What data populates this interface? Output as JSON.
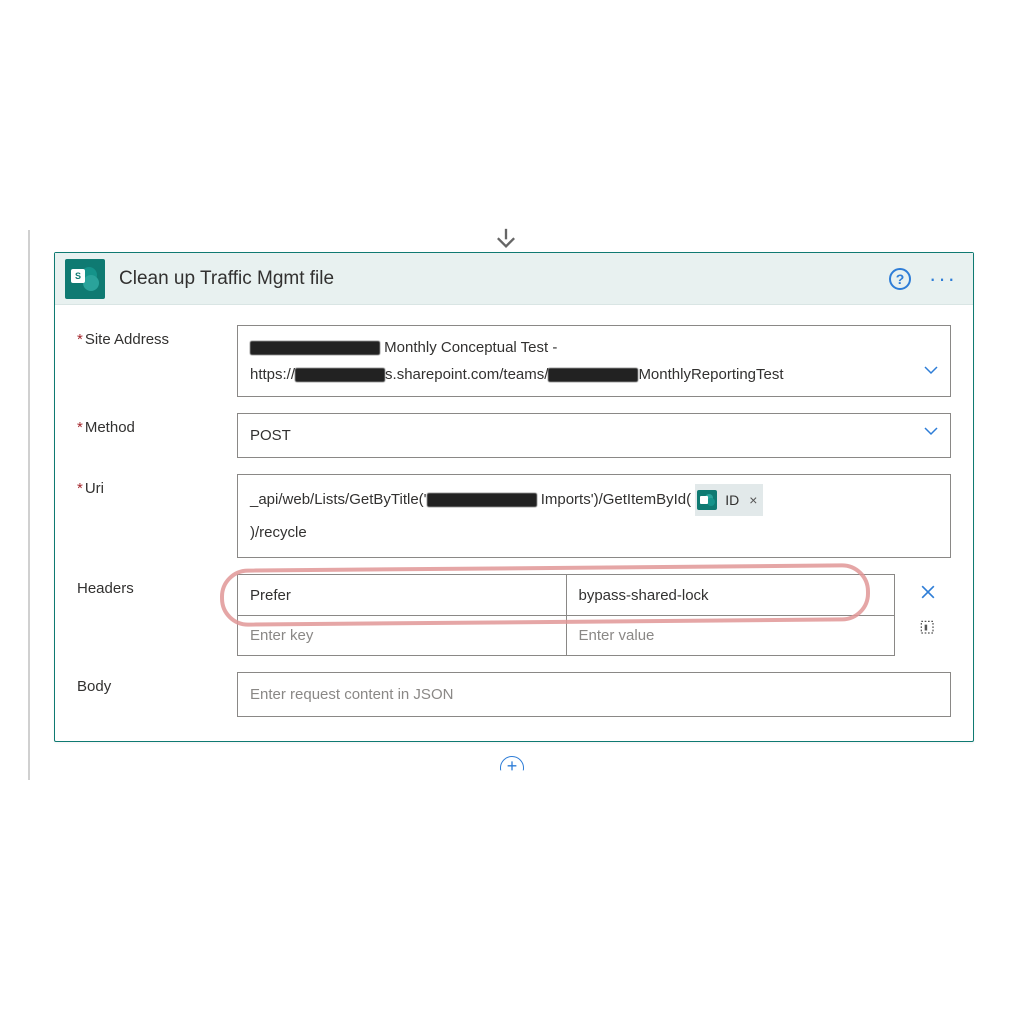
{
  "card": {
    "title": "Clean up Traffic Mgmt file",
    "icon_letter": "S"
  },
  "fields": {
    "site_address_label": "Site Address",
    "site_address_line1_after": " Monthly Conceptual Test -",
    "site_address_line2_prefix": "https://",
    "site_address_line2_mid": "s.sharepoint.com/teams/",
    "site_address_line2_suffix": "MonthlyReportingTest",
    "method_label": "Method",
    "method_value": "POST",
    "uri_label": "Uri",
    "uri_part1": "_api/web/Lists/GetByTitle('",
    "uri_part2": " Imports')/GetItemById(",
    "uri_token_label": "ID",
    "uri_part3": ")/recycle",
    "headers_label": "Headers",
    "header_key": "Prefer",
    "header_value": "bypass-shared-lock",
    "header_key_placeholder": "Enter key",
    "header_value_placeholder": "Enter value",
    "body_label": "Body",
    "body_placeholder": "Enter request content in JSON"
  }
}
